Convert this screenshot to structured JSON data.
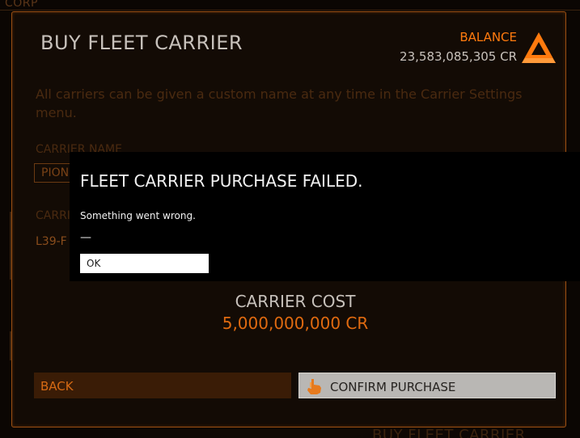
{
  "background": {
    "corp_text": "CORP",
    "bottom_title": "BUY FLEET CARRIER"
  },
  "panel": {
    "title": "BUY FLEET CARRIER",
    "balance_label": "BALANCE",
    "balance_value": "23,583,085,305 CR",
    "info_text": "All carriers can be given a custom name at any time in the Carrier Settings menu.",
    "carrier_name_label": "CARRIER NAME",
    "carrier_name_value": "PIONEER",
    "callsign_label": "CARRIER ID",
    "callsign_value": "L39-F",
    "cost_label": "CARRIER COST",
    "cost_value": "5,000,000,000 CR",
    "back_label": "BACK",
    "confirm_label": "CONFIRM PURCHASE"
  },
  "modal": {
    "title": "FLEET CARRIER PURCHASE FAILED.",
    "message": "Something went wrong.",
    "dash": "—",
    "ok_label": "OK"
  },
  "colors": {
    "accent_orange": "#ff7a0e",
    "panel_border": "#9a4f12",
    "text_light": "#c7c1bb",
    "modal_bg": "#000000"
  },
  "icons": {
    "balance": "credits-triangle-icon",
    "confirm": "hand-pointer-icon"
  }
}
